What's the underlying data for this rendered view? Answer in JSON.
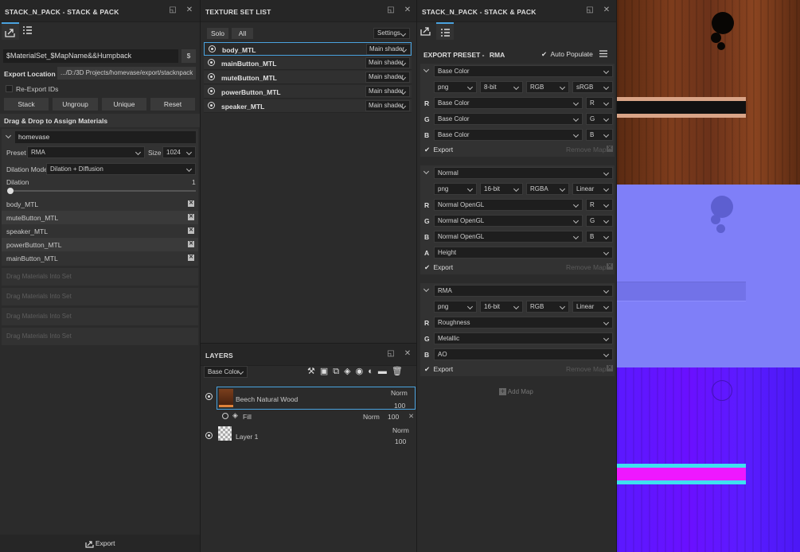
{
  "left": {
    "title": "STACK_N_PACK - STACK & PACK",
    "pattern": "$MaterialSet_$MapName&&Humpback",
    "dollar": "$",
    "export_location_label": "Export Location",
    "export_path": ".../D:/3D Projects/homevase/export/stacknpack",
    "reexport_label": "Re-Export IDs",
    "buttons": [
      "Stack",
      "Ungroup",
      "Unique",
      "Reset"
    ],
    "dnd_header": "Drag & Drop to Assign Materials",
    "set_name": "homevase",
    "preset_label": "Preset",
    "preset_value": "RMA",
    "size_label": "Size",
    "size_value": "1024",
    "dilation_mode_label": "Dilation Mode",
    "dilation_mode_value": "Dilation + Diffusion",
    "dilation_label": "Dilation",
    "dilation_value": "1",
    "dilation_fraction": 0.0,
    "materials": [
      "body_MTL",
      "muteButton_MTL",
      "speaker_MTL",
      "powerButton_MTL",
      "mainButton_MTL"
    ],
    "drop_slots": [
      "Drag Materials Into Set",
      "Drag Materials Into Set",
      "Drag Materials Into Set",
      "Drag Materials Into Set"
    ],
    "export_label": "Export"
  },
  "texset": {
    "title": "TEXTURE SET LIST",
    "solo": "Solo",
    "all": "All",
    "settings": "Settings",
    "items": [
      {
        "name": "body_MTL",
        "shader": "Main shader"
      },
      {
        "name": "mainButton_MTL",
        "shader": "Main shader"
      },
      {
        "name": "muteButton_MTL",
        "shader": "Main shader"
      },
      {
        "name": "powerButton_MTL",
        "shader": "Main shader"
      },
      {
        "name": "speaker_MTL",
        "shader": "Main shader"
      }
    ]
  },
  "layers": {
    "title": "LAYERS",
    "channel": "Base Color",
    "items": [
      {
        "name": "Beech Natural Wood",
        "blend": "Norm",
        "opacity": "100"
      },
      {
        "name": "Layer 1",
        "blend": "Norm",
        "opacity": "100"
      }
    ],
    "fill": {
      "name": "Fill",
      "blend": "Norm",
      "opacity": "100"
    }
  },
  "right": {
    "title": "STACK_N_PACK - STACK & PACK",
    "preset_label": "EXPORT PRESET -",
    "preset_name": "RMA",
    "auto_populate": "Auto Populate",
    "export_label": "Export",
    "remove_map": "Remove Map",
    "add_map": "Add Map",
    "maps": [
      {
        "name": "Base Color",
        "format": "png",
        "bits": "8-bit",
        "mode": "RGB",
        "space": "sRGB",
        "channels": [
          {
            "ch": "R",
            "src": "Base Color",
            "sub": "R"
          },
          {
            "ch": "G",
            "src": "Base Color",
            "sub": "G"
          },
          {
            "ch": "B",
            "src": "Base Color",
            "sub": "B"
          }
        ]
      },
      {
        "name": "Normal",
        "format": "png",
        "bits": "16-bit",
        "mode": "RGBA",
        "space": "Linear",
        "channels": [
          {
            "ch": "R",
            "src": "Normal OpenGL",
            "sub": "R"
          },
          {
            "ch": "G",
            "src": "Normal OpenGL",
            "sub": "G"
          },
          {
            "ch": "B",
            "src": "Normal OpenGL",
            "sub": "B"
          }
        ],
        "alpha": {
          "ch": "A",
          "src": "Height"
        }
      },
      {
        "name": "RMA",
        "format": "png",
        "bits": "16-bit",
        "mode": "RGB",
        "space": "Linear",
        "channels": [
          {
            "ch": "R",
            "src": "Roughness"
          },
          {
            "ch": "G",
            "src": "Metallic"
          },
          {
            "ch": "B",
            "src": "AO"
          }
        ]
      }
    ]
  }
}
